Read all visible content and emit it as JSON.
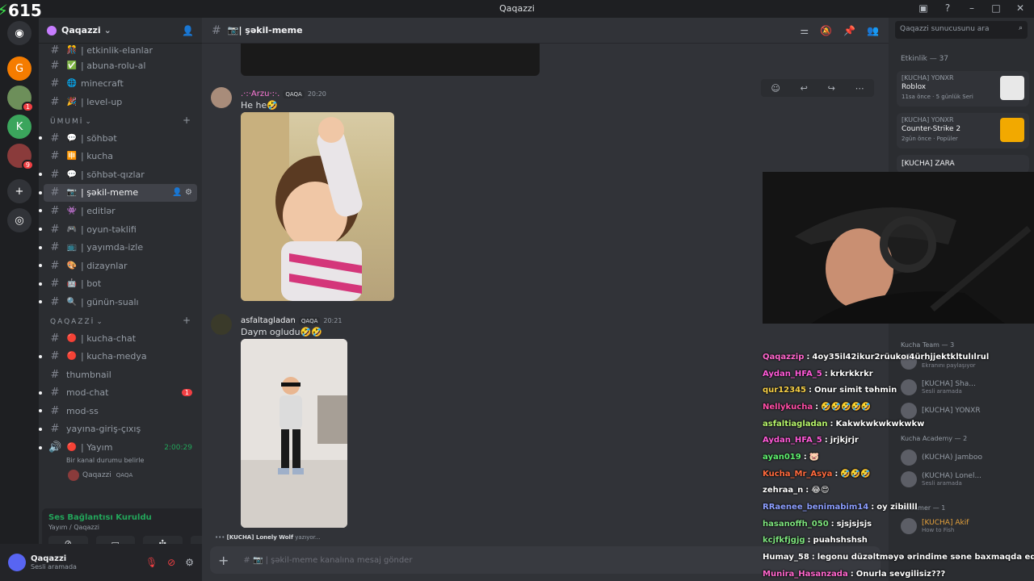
{
  "titlebar": {
    "title": "Qaqazzi"
  },
  "overlay_counter": "615",
  "server": {
    "name": "Qaqazzi"
  },
  "channels_top": [
    {
      "emoji": "🎊",
      "label": "| etkinlik-elanlar"
    },
    {
      "emoji": "✅",
      "label": "| abuna-rolu-al"
    },
    {
      "emoji": "🌐",
      "label": "minecraft"
    },
    {
      "emoji": "🎉",
      "label": "| level-up"
    }
  ],
  "category_umumi": "ÜMUMİ",
  "channels_umumi": [
    {
      "emoji": "💬",
      "label": "| söhbət"
    },
    {
      "emoji": "🈸",
      "label": "| kucha"
    },
    {
      "emoji": "💬",
      "label": "| söhbət-qızlar"
    },
    {
      "emoji": "📷",
      "label": "| şəkil-meme",
      "active": true
    },
    {
      "emoji": "👾",
      "label": "| editlər"
    },
    {
      "emoji": "🎮",
      "label": "| oyun-təklifi"
    },
    {
      "emoji": "📺",
      "label": "| yayımda-izle"
    },
    {
      "emoji": "🎨",
      "label": "| dizaynlar"
    },
    {
      "emoji": "🤖",
      "label": "| bot"
    },
    {
      "emoji": "🔍",
      "label": "| günün-sualı"
    }
  ],
  "category_qaqazzi": "QAQAZZİ",
  "channels_qaqazzi": [
    {
      "emoji": "🔴",
      "label": "| kucha-chat"
    },
    {
      "emoji": "🔴",
      "label": "| kucha-medya"
    },
    {
      "emoji": "",
      "label": "thumbnail"
    },
    {
      "emoji": "",
      "label": "mod-chat",
      "badge": "1"
    },
    {
      "emoji": "",
      "label": "mod-ss"
    },
    {
      "emoji": "",
      "label": "yayına-giriş-çıxış"
    }
  ],
  "voice_channel": {
    "label": "| Yayım",
    "time": "2:00:29",
    "status": "Bir kanal durumu belirle",
    "user": "Qaqazzi",
    "tag": "QAQA"
  },
  "voice_panel": {
    "connected": "Ses Bağlantısı Kuruldu",
    "sub": "Yayım / Qaqazzi"
  },
  "userbar": {
    "name": "Qaqazzi",
    "status": "Sesli aramada"
  },
  "main": {
    "channel_title": "| şəkil-meme",
    "messages": [
      {
        "name": ".·:·Arzu·:·.",
        "tag": "QAQA",
        "time": "20:20",
        "text": "He he🤣"
      },
      {
        "name": "asfaltagladan",
        "tag": "QAQA",
        "time": "20:21",
        "text": "Daym ogludu🤣🤣"
      }
    ],
    "typing_user": "[KUCHA] Lonely Wolf",
    "typing_text": "yazıyor...",
    "composer_placeholder": "# 📷 | şəkil-meme kanalına mesaj gönder"
  },
  "search": {
    "placeholder": "Qaqazzi sunucusunu ara"
  },
  "activity": {
    "header": "Etkinlik — 37",
    "cards": [
      {
        "user": "[KUCHA] YONXR",
        "game": "Roblox",
        "meta": "11sa önce · 5 günlük Seri"
      },
      {
        "user": "[KUCHA] YONXR",
        "game": "Counter-Strike 2",
        "meta": "2gün önce · Popüler"
      },
      {
        "user": "[KUCHA] ZARA",
        "game": "",
        "meta": ""
      }
    ]
  },
  "member_groups": [
    {
      "label": "Kucha Team — 3"
    },
    {
      "label": "Kucha Academy — 2"
    },
    {
      "label": "Streamer — 1"
    }
  ],
  "members": [
    {
      "name": "...",
      "sub": "Ekranını paylaşıyor"
    },
    {
      "name": "[KUCHA] Sha...",
      "sub": "Sesli aramada"
    },
    {
      "name": "[KUCHA] YONXR",
      "sub": ""
    },
    {
      "name": "(KUCHA) Jamboo",
      "sub": ""
    },
    {
      "name": "(KUCHA) Lonel...",
      "sub": "Sesli aramada"
    },
    {
      "name": "[KUCHA] Akif",
      "sub": "How to Fish"
    }
  ],
  "stream_chat": [
    {
      "user": "Qaqazzip",
      "color": "#ff66cc",
      "msg": "4oy35il42ikur2rüukoı4ürhjjektkltulılrul"
    },
    {
      "user": "Aydan_HFA_5",
      "color": "#ff5ad8",
      "msg": "krkrkkrkr"
    },
    {
      "user": "qur12345",
      "color": "#f7d046",
      "msg": "Onur simit təhmin"
    },
    {
      "user": "Nellykucha",
      "color": "#ff4da6",
      "msg": "🤣🤣🤣🤣🤣"
    },
    {
      "user": "asfaltiagladan",
      "color": "#b7f56b",
      "msg": "Kakwkwkwkwkwkw"
    },
    {
      "user": "Aydan_HFA_5",
      "color": "#ff5ad8",
      "msg": "jrjkjrjr"
    },
    {
      "user": "ayan019",
      "color": "#5ef06e",
      "msg": "🐷"
    },
    {
      "user": "Kucha_Mr_Asya",
      "color": "#ff6a3d",
      "msg": "🤣🤣🤣"
    },
    {
      "user": "zehraa_n",
      "color": "#ffffff",
      "msg": "😂😍"
    },
    {
      "user": "RRaenee_benimabim14",
      "color": "#8c9eff",
      "msg": "oy zibillll"
    },
    {
      "user": "hasanoffh_050",
      "color": "#7de37d",
      "msg": "sjsjsjsjs"
    },
    {
      "user": "kcjfkfjgjg",
      "color": "#7de37d",
      "msg": "puahshshsh"
    },
    {
      "user": "Humay_58",
      "color": "#ffffff",
      "msg": "legonu düzəltməyə ərindime səne baxmaqda edə bilm"
    },
    {
      "user": "Munira_Hasanzada",
      "color": "#ff66cc",
      "msg": "Onurla sevgilisiz???"
    }
  ]
}
